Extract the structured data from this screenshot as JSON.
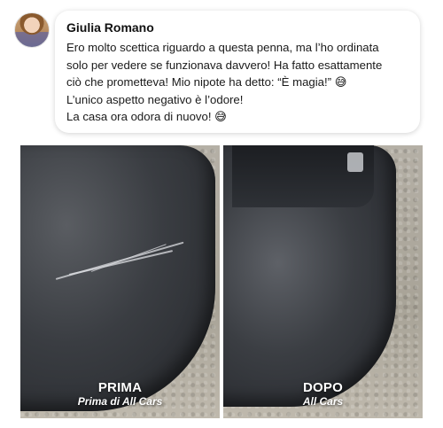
{
  "review": {
    "author": "Giulia Romano",
    "lines": [
      "Ero molto scettica riguardo a questa penna, ma l’ho ordinata",
      "solo per vedere se funzionava davvero! Ha fatto esattamente",
      "ciò che prometteva! Mio nipote ha detto: “È magia!” 😅",
      "L’unico aspetto negativo è l’odore!",
      "La casa ora odora di nuovo! 😅"
    ]
  },
  "photos": {
    "before": {
      "title": "PRIMA",
      "subtitle": "Prima di All Cars"
    },
    "after": {
      "title": "DOPO",
      "subtitle": "All Cars"
    }
  }
}
